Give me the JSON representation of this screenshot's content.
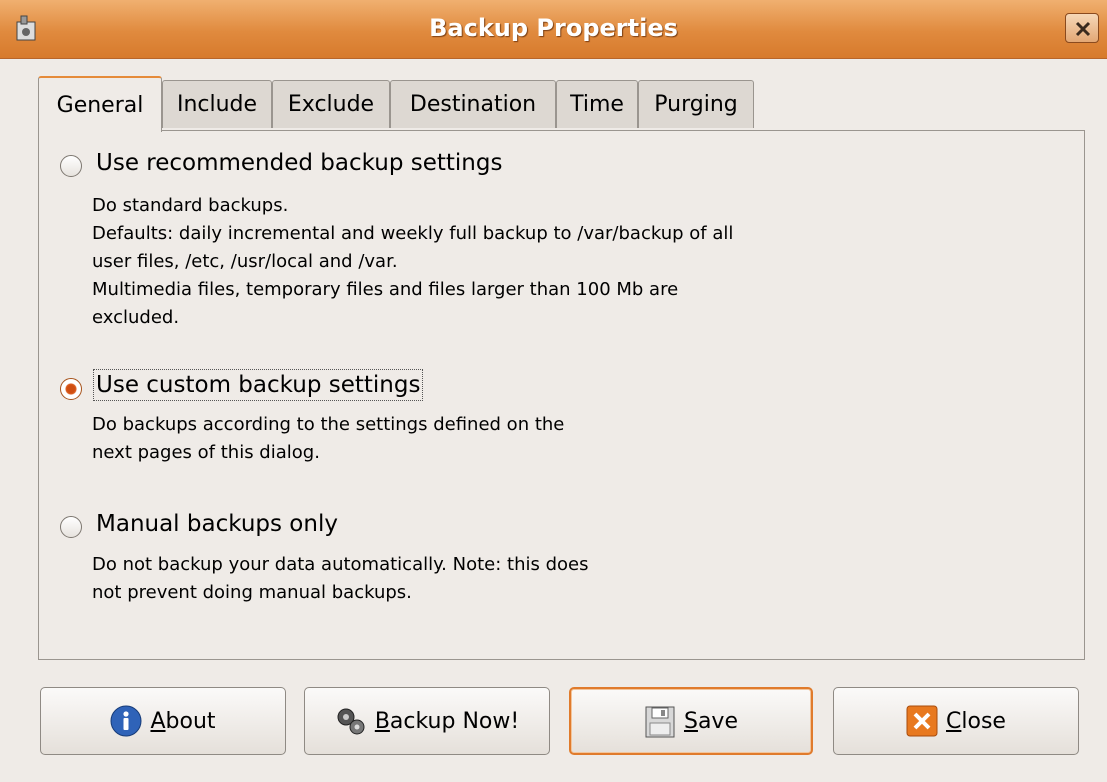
{
  "window": {
    "title": "Backup Properties",
    "app_icon": "backup-app-icon",
    "close_icon": "close-x-icon"
  },
  "tabs": [
    {
      "label": "General",
      "active": true
    },
    {
      "label": "Include",
      "active": false
    },
    {
      "label": "Exclude",
      "active": false
    },
    {
      "label": "Destination",
      "active": false
    },
    {
      "label": "Time",
      "active": false
    },
    {
      "label": "Purging",
      "active": false
    }
  ],
  "options": [
    {
      "label": "Use recommended backup settings",
      "checked": false,
      "description": "Do standard backups.\nDefaults: daily incremental and weekly full backup to /var/backup of all\nuser files, /etc, /usr/local and /var.\nMultimedia files, temporary files and files larger than 100 Mb are\nexcluded."
    },
    {
      "label": "Use custom backup settings",
      "checked": true,
      "description": "Do backups according to the settings defined on the\nnext pages of this dialog."
    },
    {
      "label": "Manual backups only",
      "checked": false,
      "description": "Do not backup your data automatically. Note: this does\nnot prevent doing manual backups."
    }
  ],
  "buttons": {
    "about": {
      "mnemonic": "A",
      "rest": "bout",
      "icon": "info-icon"
    },
    "backup_now": {
      "mnemonic": "B",
      "rest": "ackup Now!",
      "icon": "gears-icon"
    },
    "save": {
      "mnemonic": "S",
      "rest": "ave",
      "icon": "floppy-disk-icon"
    },
    "close": {
      "mnemonic": "C",
      "rest": "lose",
      "icon": "close-icon"
    }
  },
  "colors": {
    "titlebar": "#e08a3e",
    "accent": "#e07b2c",
    "background": "#efebe7"
  }
}
